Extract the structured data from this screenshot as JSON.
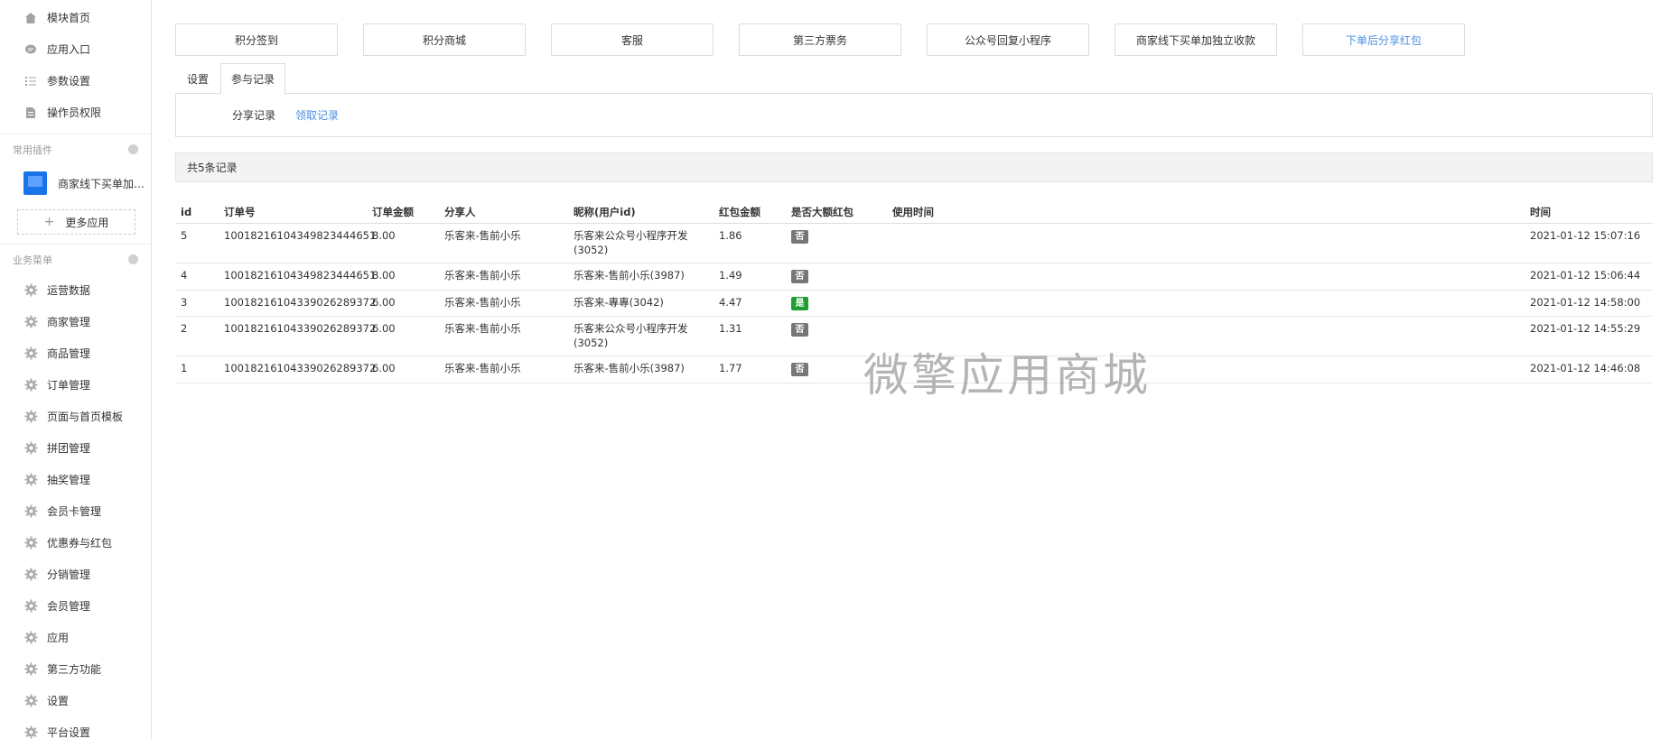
{
  "sidebar": {
    "top_items": [
      {
        "label": "模块首页",
        "icon": "home-icon"
      },
      {
        "label": "应用入口",
        "icon": "chat-icon"
      },
      {
        "label": "参数设置",
        "icon": "list-icon"
      },
      {
        "label": "操作员权限",
        "icon": "document-icon"
      }
    ],
    "plugins_header": "常用插件",
    "plugin": {
      "label": "商家线下买单加独..."
    },
    "more_apps": "更多应用",
    "business_header": "业务菜单",
    "business_items": [
      {
        "label": "运营数据"
      },
      {
        "label": "商家管理"
      },
      {
        "label": "商品管理"
      },
      {
        "label": "订单管理"
      },
      {
        "label": "页面与首页模板"
      },
      {
        "label": "拼团管理"
      },
      {
        "label": "抽奖管理"
      },
      {
        "label": "会员卡管理"
      },
      {
        "label": "优惠券与红包"
      },
      {
        "label": "分销管理"
      },
      {
        "label": "会员管理"
      },
      {
        "label": "应用"
      },
      {
        "label": "第三方功能"
      },
      {
        "label": "设置"
      },
      {
        "label": "平台设置"
      }
    ]
  },
  "toolbar": {
    "buttons": [
      {
        "label": "积分签到"
      },
      {
        "label": "积分商城"
      },
      {
        "label": "客服"
      },
      {
        "label": "第三方票务"
      },
      {
        "label": "公众号回复小程序"
      },
      {
        "label": "商家线下买单加独立收款"
      },
      {
        "label": "下单后分享红包"
      }
    ]
  },
  "tabs": [
    {
      "label": "设置"
    },
    {
      "label": "参与记录"
    }
  ],
  "subnav": {
    "share_record": "分享记录",
    "receive_record": "领取记录"
  },
  "record_count": "共5条记录",
  "table": {
    "headers": {
      "id": "id",
      "order": "订单号",
      "amount": "订单金额",
      "sharer": "分享人",
      "nickname": "昵称(用户id)",
      "red_amount": "红包金额",
      "is_big": "是否大额红包",
      "use_time": "使用时间",
      "time": "时间"
    },
    "rows": [
      {
        "id": "5",
        "order": "1001821610434982344465​1",
        "amount": "8.00",
        "sharer": "乐客来-售前小乐",
        "nickname": "乐客来公众号小程序开发(3052)",
        "red_amount": "1.86",
        "is_big": "否",
        "use_time": "",
        "time": "2021-01-12 15:07:16"
      },
      {
        "id": "4",
        "order": "10018216104349823444651",
        "amount": "8.00",
        "sharer": "乐客来-售前小乐",
        "nickname": "乐客来-售前小乐(3987)",
        "red_amount": "1.49",
        "is_big": "否",
        "use_time": "",
        "time": "2021-01-12 15:06:44"
      },
      {
        "id": "3",
        "order": "10018216104339026289372",
        "amount": "6.00",
        "sharer": "乐客来-售前小乐",
        "nickname": "乐客来-專專(3042)",
        "red_amount": "4.47",
        "is_big": "是",
        "use_time": "",
        "time": "2021-01-12 14:58:00"
      },
      {
        "id": "2",
        "order": "10018216104339026289372",
        "amount": "6.00",
        "sharer": "乐客来-售前小乐",
        "nickname": "乐客来公众号小程序开发(3052)",
        "red_amount": "1.31",
        "is_big": "否",
        "use_time": "",
        "time": "2021-01-12 14:55:29"
      },
      {
        "id": "1",
        "order": "10018216104339026289372",
        "amount": "6.00",
        "sharer": "乐客来-售前小乐",
        "nickname": "乐客来-售前小乐(3987)",
        "red_amount": "1.77",
        "is_big": "否",
        "use_time": "",
        "time": "2021-01-12 14:46:08"
      }
    ]
  },
  "watermark": "微擎应用商城",
  "colors": {
    "accent": "#4a90e2",
    "badge_no": "#777777",
    "badge_yes": "#1f9d2f"
  }
}
